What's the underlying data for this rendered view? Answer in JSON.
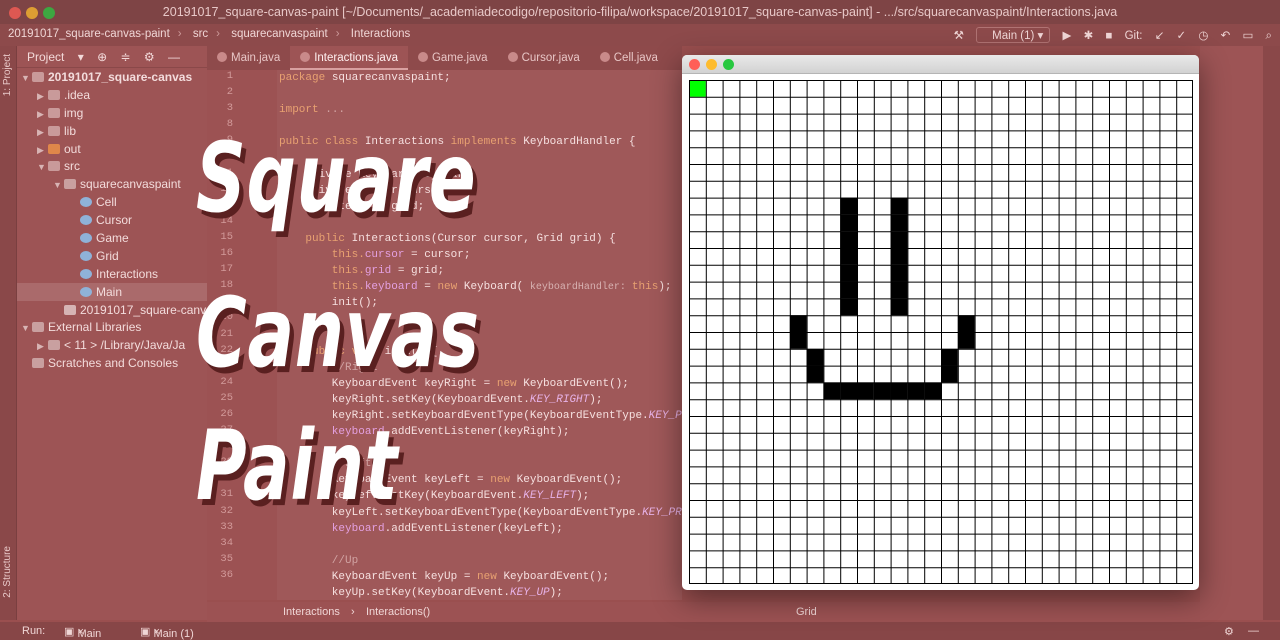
{
  "window": {
    "title": "20191017_square-canvas-paint [~/Documents/_academiadecodigo/repositorio-filipa/workspace/20191017_square-canvas-paint] - .../src/squarecanvaspaint/Interactions.java",
    "dots": [
      "#ff5f57",
      "#febc2e",
      "#28c840"
    ]
  },
  "navbar": {
    "crumbs": [
      "20191017_square-canvas-paint",
      "src",
      "squarecanvaspaint",
      "Interactions"
    ],
    "run_config": "Main (1)",
    "git_label": "Git:"
  },
  "left_strip": {
    "project_tab": "1: Project",
    "structure_tab": "2: Structure"
  },
  "project_panel": {
    "header": "Project",
    "tree": [
      {
        "label": "20191017_square-canvas",
        "indent": 0,
        "kind": "folder",
        "bold": true
      },
      {
        "label": ".idea",
        "indent": 1,
        "kind": "folder"
      },
      {
        "label": "img",
        "indent": 1,
        "kind": "folder"
      },
      {
        "label": "lib",
        "indent": 1,
        "kind": "folder"
      },
      {
        "label": "out",
        "indent": 1,
        "kind": "folder-orange"
      },
      {
        "label": "src",
        "indent": 1,
        "kind": "folder"
      },
      {
        "label": "squarecanvaspaint",
        "indent": 2,
        "kind": "package"
      },
      {
        "label": "Cell",
        "indent": 3,
        "kind": "class"
      },
      {
        "label": "Cursor",
        "indent": 3,
        "kind": "class"
      },
      {
        "label": "Game",
        "indent": 3,
        "kind": "class"
      },
      {
        "label": "Grid",
        "indent": 3,
        "kind": "class"
      },
      {
        "label": "Interactions",
        "indent": 3,
        "kind": "class"
      },
      {
        "label": "Main",
        "indent": 3,
        "kind": "class",
        "selected": true
      },
      {
        "label": "20191017_square-canva",
        "indent": 2,
        "kind": "file"
      },
      {
        "label": "External Libraries",
        "indent": 0,
        "kind": "lib"
      },
      {
        "label": "< 11 >  /Library/Java/Ja",
        "indent": 1,
        "kind": "lib"
      },
      {
        "label": "Scratches and Consoles",
        "indent": 0,
        "kind": "scratch"
      }
    ]
  },
  "editor": {
    "tabs": [
      {
        "label": "Main.java",
        "active": false
      },
      {
        "label": "Interactions.java",
        "active": true
      },
      {
        "label": "Game.java",
        "active": false
      },
      {
        "label": "Cursor.java",
        "active": false
      },
      {
        "label": "Cell.java",
        "active": false
      }
    ],
    "line_numbers": [
      "1",
      "2",
      "3",
      "8",
      "9",
      "10",
      "11",
      "12",
      "13",
      "14",
      "15",
      "16",
      "17",
      "18",
      "19",
      "20",
      "21",
      "22",
      "23",
      "24",
      "25",
      "26",
      "27",
      "28",
      "29",
      "30",
      "31",
      "32",
      "33",
      "34",
      "35",
      "36"
    ],
    "lines": [
      [
        {
          "t": "package ",
          "c": "k"
        },
        {
          "t": "squarecanvaspaint;",
          "c": ""
        }
      ],
      [],
      [
        {
          "t": "import ",
          "c": "k"
        },
        {
          "t": "...",
          "c": "cmt"
        }
      ],
      [],
      [
        {
          "t": "public class ",
          "c": "k"
        },
        {
          "t": "Interactions ",
          "c": ""
        },
        {
          "t": "implements ",
          "c": "k"
        },
        {
          "t": "KeyboardHandler {",
          "c": ""
        }
      ],
      [],
      [
        {
          "t": "    private Keyboard keyboard;",
          "c": ""
        }
      ],
      [
        {
          "t": "    private Cursor cursor;",
          "c": ""
        }
      ],
      [
        {
          "t": "    private Grid grid;",
          "c": ""
        }
      ],
      [],
      [
        {
          "t": "    public ",
          "c": "k"
        },
        {
          "t": "Interactions(Cursor cursor, Grid grid) {",
          "c": ""
        }
      ],
      [
        {
          "t": "        this.",
          "c": "k"
        },
        {
          "t": "cursor",
          "c": "fld"
        },
        {
          "t": " = cursor;",
          "c": ""
        }
      ],
      [
        {
          "t": "        this.",
          "c": "k"
        },
        {
          "t": "grid",
          "c": "fld"
        },
        {
          "t": " = grid;",
          "c": ""
        }
      ],
      [
        {
          "t": "        this.",
          "c": "k"
        },
        {
          "t": "keyboard",
          "c": "fld"
        },
        {
          "t": " = ",
          "c": ""
        },
        {
          "t": "new ",
          "c": "k"
        },
        {
          "t": "Keyboard( ",
          "c": ""
        },
        {
          "t": "keyboardHandler: ",
          "c": "hint"
        },
        {
          "t": "this",
          "c": "k"
        },
        {
          "t": ");",
          "c": ""
        }
      ],
      [
        {
          "t": "        init();",
          "c": ""
        }
      ],
      [
        {
          "t": "    }",
          "c": ""
        }
      ],
      [],
      [
        {
          "t": "    public void ",
          "c": "k"
        },
        {
          "t": "init() {",
          "c": ""
        }
      ],
      [
        {
          "t": "        //Right",
          "c": "cmt"
        }
      ],
      [
        {
          "t": "        KeyboardEvent keyRight = ",
          "c": ""
        },
        {
          "t": "new ",
          "c": "k"
        },
        {
          "t": "KeyboardEvent();",
          "c": ""
        }
      ],
      [
        {
          "t": "        keyRight.setKey(KeyboardEvent.",
          "c": ""
        },
        {
          "t": "KEY_RIGHT",
          "c": "kst"
        },
        {
          "t": ");",
          "c": ""
        }
      ],
      [
        {
          "t": "        keyRight.setKeyboardEventType(KeyboardEventType.",
          "c": ""
        },
        {
          "t": "KEY_PRESSED",
          "c": "kst"
        },
        {
          "t": ");",
          "c": ""
        }
      ],
      [
        {
          "t": "        keyboard",
          "c": "fld"
        },
        {
          "t": ".addEventListener(keyRight);",
          "c": ""
        }
      ],
      [],
      [
        {
          "t": "        //Left",
          "c": "cmt"
        }
      ],
      [
        {
          "t": "        KeyboardEvent keyLeft = ",
          "c": ""
        },
        {
          "t": "new ",
          "c": "k"
        },
        {
          "t": "KeyboardEvent();",
          "c": ""
        }
      ],
      [
        {
          "t": "        keyLeft.setKey(KeyboardEvent.",
          "c": ""
        },
        {
          "t": "KEY_LEFT",
          "c": "kst"
        },
        {
          "t": ");",
          "c": ""
        }
      ],
      [
        {
          "t": "        keyLeft.setKeyboardEventType(KeyboardEventType.",
          "c": ""
        },
        {
          "t": "KEY_PRESSED",
          "c": "kst"
        },
        {
          "t": ");",
          "c": ""
        }
      ],
      [
        {
          "t": "        keyboard",
          "c": "fld"
        },
        {
          "t": ".addEventListener(keyLeft);",
          "c": ""
        }
      ],
      [],
      [
        {
          "t": "        //Up",
          "c": "cmt"
        }
      ],
      [
        {
          "t": "        KeyboardEvent keyUp = ",
          "c": ""
        },
        {
          "t": "new ",
          "c": "k"
        },
        {
          "t": "KeyboardEvent();",
          "c": ""
        }
      ],
      [
        {
          "t": "        keyUp.setKey(KeyboardEvent.",
          "c": ""
        },
        {
          "t": "KEY_UP",
          "c": "kst"
        },
        {
          "t": ");",
          "c": ""
        }
      ]
    ]
  },
  "breadcrumb_bottom": {
    "class": "Interactions",
    "method": "Interactions()",
    "right": "Grid"
  },
  "status": {
    "run_label": "Run:",
    "run_tabs": [
      "Main",
      "Main (1)"
    ]
  },
  "overlay_title": [
    "Square",
    "Canvas",
    "Paint"
  ],
  "canvas_app": {
    "dots": [
      "#ff5f57",
      "#febc2e",
      "#28c840"
    ],
    "grid": {
      "cols": 30,
      "rows": 30,
      "cursor_color": "#00ff00",
      "cursor_cell": [
        0,
        0
      ],
      "paint_color": "#000000",
      "painted_cells": [
        [
          9,
          7
        ],
        [
          9,
          8
        ],
        [
          9,
          9
        ],
        [
          9,
          10
        ],
        [
          9,
          11
        ],
        [
          9,
          12
        ],
        [
          9,
          13
        ],
        [
          12,
          7
        ],
        [
          12,
          8
        ],
        [
          12,
          9
        ],
        [
          12,
          10
        ],
        [
          12,
          11
        ],
        [
          12,
          12
        ],
        [
          12,
          13
        ],
        [
          6,
          14
        ],
        [
          6,
          15
        ],
        [
          16,
          14
        ],
        [
          16,
          15
        ],
        [
          7,
          16
        ],
        [
          7,
          17
        ],
        [
          15,
          16
        ],
        [
          15,
          17
        ],
        [
          8,
          18
        ],
        [
          9,
          18
        ],
        [
          10,
          18
        ],
        [
          11,
          18
        ],
        [
          12,
          18
        ],
        [
          13,
          18
        ],
        [
          14,
          18
        ]
      ]
    }
  }
}
